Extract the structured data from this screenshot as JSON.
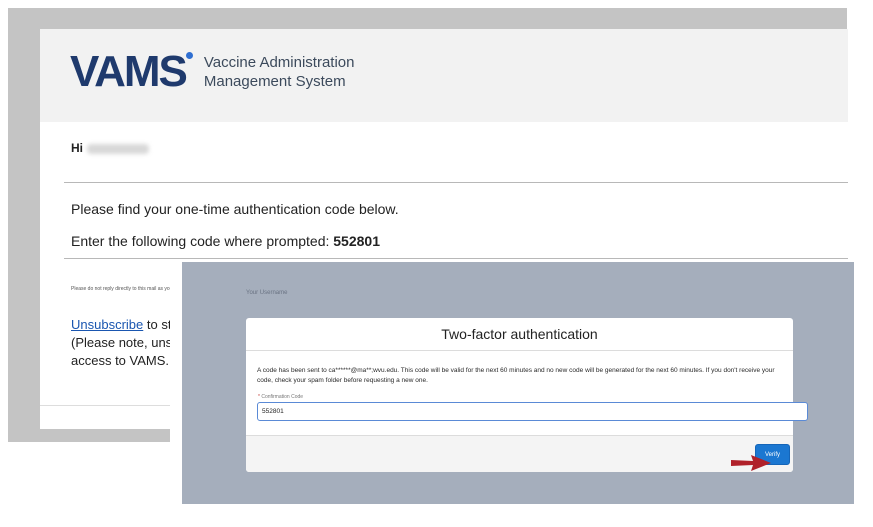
{
  "email": {
    "logo_mark": "VAMS",
    "logo_line1": "Vaccine Administration",
    "logo_line2": "Management System",
    "greeting_prefix": "Hi",
    "line1": "Please find your one-time authentication code below.",
    "line2_prefix": "Enter the following code where prompted: ",
    "code": "552801",
    "no_reply_note": "Please do not reply directly to this mail as your response will not be received.",
    "unsubscribe_link": "Unsubscribe",
    "unsubscribe_rest": " to stop",
    "unsub_line2": "(Please note, unsub",
    "unsub_line3": "access to VAMS. If y"
  },
  "tfa": {
    "username_label": "Your Username",
    "title": "Two-factor authentication",
    "message": "A code has been sent to ca******@ma**;wvu.edu. This code will be valid for the next 60 minutes and no new code will be generated for the next 60 minutes. If you don't receive your code, check your spam folder before requesting a new one.",
    "field_label": "Confirmation Code",
    "field_required_mark": "*",
    "field_value": "552801",
    "verify_label": "Verify"
  },
  "colors": {
    "brand_navy": "#1f3a6d",
    "link_blue": "#1a56b0",
    "button_blue": "#1b77d1",
    "overlay_gray": "#a5aebc",
    "arrow_red": "#b0212a"
  },
  "icons": {
    "annotation_arrow": "red-arrow-icon"
  }
}
